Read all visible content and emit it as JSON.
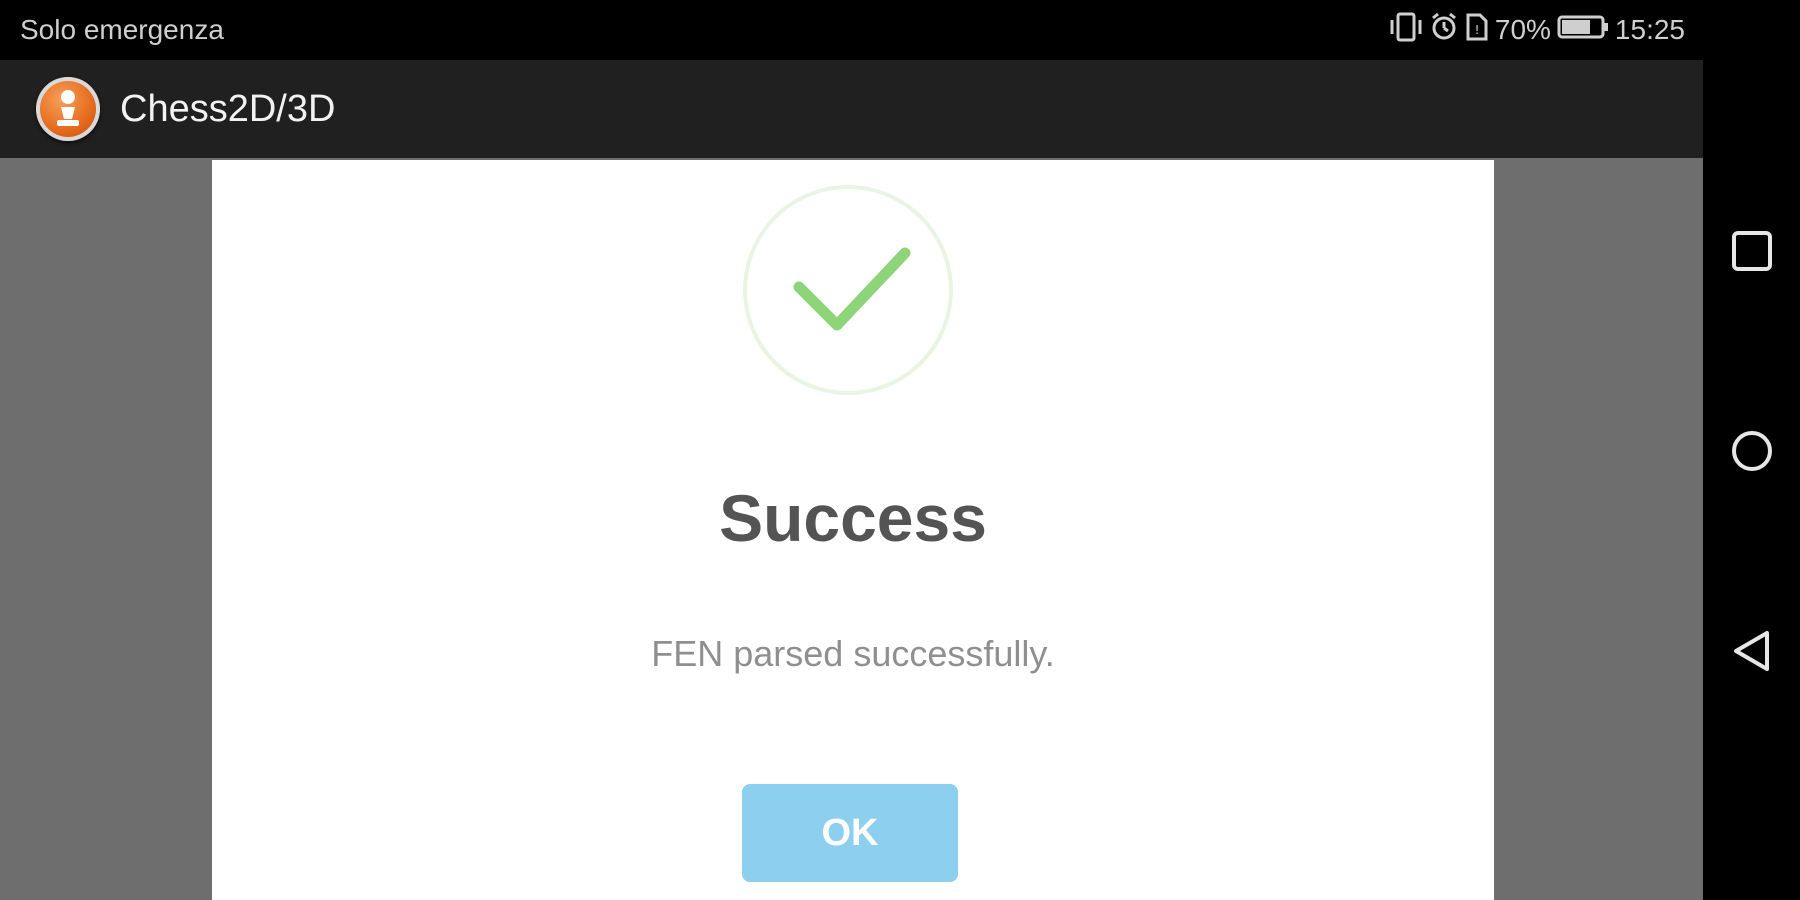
{
  "status_bar": {
    "carrier": "Solo emergenza",
    "battery_percent": "70%",
    "time": "15:25",
    "icons": [
      "vibrate-icon",
      "alarm-icon",
      "sim-icon",
      "battery-icon"
    ]
  },
  "app_bar": {
    "title": "Chess2D/3D",
    "logo_icon": "chess-pawn-icon"
  },
  "dialog": {
    "icon": "checkmark-icon",
    "title": "Success",
    "message": "FEN parsed successfully.",
    "ok_label": "OK"
  },
  "nav_bar": {
    "buttons": [
      "recent-apps-icon",
      "home-icon",
      "back-icon"
    ]
  },
  "colors": {
    "accent_green": "#8ed57a",
    "ok_button": "#8ccfee",
    "app_bar": "#202020",
    "overlay": "#6e6e6e"
  }
}
